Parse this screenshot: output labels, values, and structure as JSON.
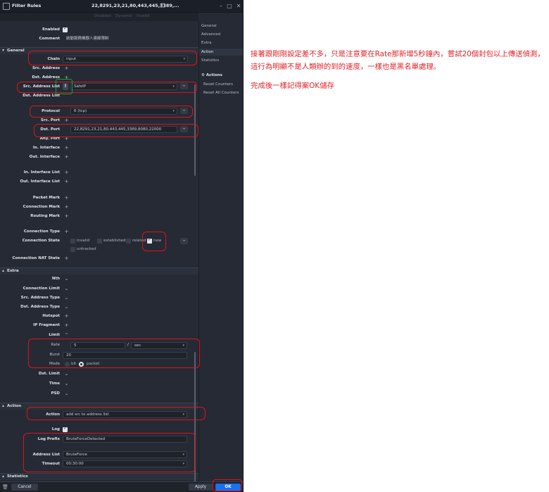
{
  "window": {
    "title": "Filter Rules",
    "rule_title": "22,8291,23,21,80,443,445,3389,...",
    "copy_icon": "copy-icon",
    "min_icon": "minimize-icon",
    "max_icon": "maximize-icon",
    "close_icon": "close-icon"
  },
  "subtabs": [
    "Disabled",
    "Dynamic",
    "Invalid"
  ],
  "rows": {
    "enabled": {
      "label": "Enabled",
      "checked": true
    },
    "comment": {
      "label": "Comment",
      "value": "啟動服務機器人連線限制"
    },
    "general_header": "General",
    "chain": {
      "label": "Chain",
      "value": "input"
    },
    "src_address": "Src. Address",
    "dst_address": "Dst. Address",
    "src_address_list": {
      "label": "Src. Address List",
      "value": "SafeIP",
      "negate": "!"
    },
    "dst_address_list": "Dst. Address List",
    "protocol": {
      "label": "Protocol",
      "value": "6 (tcp)"
    },
    "src_port": "Src. Port",
    "dst_port": {
      "label": "Dst. Port",
      "value": "22,8291,23,21,80,443,445,3389,8080,22000"
    },
    "any_port": "Any. Port",
    "in_interface": "In. Interface",
    "out_interface": "Out. Interface",
    "in_interface_list": "In. Interface List",
    "out_interface_list": "Out. Interface List",
    "packet_mark": "Packet Mark",
    "connection_mark": "Connection Mark",
    "routing_mark": "Routing Mark",
    "connection_type": "Connection Type",
    "connection_state": {
      "label": "Connection State",
      "options": [
        "invalid",
        "established",
        "related",
        "new",
        "untracked"
      ],
      "checked": [
        false,
        false,
        false,
        true,
        false
      ]
    },
    "connection_nat_state": "Connection NAT State",
    "extra_header": "Extra",
    "nth": "Nth",
    "connection_limit": "Connection Limit",
    "src_address_type": "Src. Address Type",
    "dst_address_type": "Dst. Address Type",
    "hotspot": "Hotspot",
    "ip_fragment": "IP Fragment",
    "limit": "Limit",
    "rate": {
      "label": "Rate",
      "value": "5",
      "sep": "/",
      "unit": "sec"
    },
    "burst": {
      "label": "Burst",
      "value": "20"
    },
    "mode": {
      "label": "Mode",
      "options": [
        "bit",
        "packet"
      ],
      "selected": "packet"
    },
    "dst_limit": "Dst. Limit",
    "time": "Time",
    "psd": "PSD",
    "action_header": "Action",
    "action": {
      "label": "Action",
      "value": "add src to address list"
    },
    "log": {
      "label": "Log",
      "checked": true
    },
    "log_prefix": {
      "label": "Log Prefix",
      "value": "BruteForceDetected"
    },
    "address_list": {
      "label": "Address List",
      "value": "BruteForce"
    },
    "timeout": {
      "label": "Timeout",
      "value": "00:30:00"
    },
    "statistics_header": "Statistics"
  },
  "right_panel": {
    "tabs": [
      "General",
      "Advanced",
      "Extra",
      "Action",
      "Statistics"
    ],
    "selected": "Action",
    "actions_title": "Actions",
    "actions": [
      "Reset Counters",
      "Reset All Counters"
    ]
  },
  "bottom": {
    "cancel": "Cancel",
    "apply": "Apply",
    "ok": "OK"
  },
  "note": [
    "接著跟剛剛設定差不多，只是注意要在Rate那新增5秒鐘內，嘗試20個封包以上傳送偵測，這行為明顯不是人類辦的到的速度，一樣也是黑名單處理。",
    "完成後一樣記得案OK儲存"
  ],
  "colors": {
    "annotation": "#e1121b",
    "highlight": "#11a639",
    "ok_button": "#1b6ff0"
  }
}
